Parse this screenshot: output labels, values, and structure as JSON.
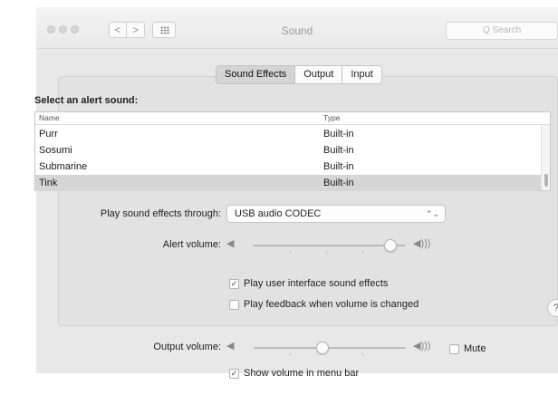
{
  "window": {
    "title": "Sound",
    "search_placeholder": "Q Search",
    "nav_back": "<",
    "nav_forward": ">"
  },
  "tabs": [
    {
      "label": "Sound Effects",
      "active": true
    },
    {
      "label": "Output",
      "active": false
    },
    {
      "label": "Input",
      "active": false
    }
  ],
  "alert": {
    "heading": "Select an alert sound:",
    "columns": [
      "Name",
      "Type"
    ],
    "rows": [
      {
        "name": "Purr",
        "type": "Built-in"
      },
      {
        "name": "Sosumi",
        "type": "Built-in"
      },
      {
        "name": "Submarine",
        "type": "Built-in"
      },
      {
        "name": "Tink",
        "type": "Built-in",
        "selected": true
      }
    ]
  },
  "play_through": {
    "label": "Play sound effects through:",
    "value": "USB audio CODEC"
  },
  "alert_volume": {
    "label": "Alert volume:",
    "level": 0.9
  },
  "checkboxes": [
    {
      "label": "Play user interface sound effects",
      "checked": true
    },
    {
      "label": "Play feedback when volume is changed",
      "checked": false
    }
  ],
  "output_volume": {
    "label": "Output volume:",
    "level": 0.45,
    "mute_label": "Mute",
    "mute_checked": false
  },
  "menu_bar": {
    "label": "Show volume in menu bar",
    "checked": true
  },
  "help": "?",
  "colors": {
    "window_bg": "#e8e8e8",
    "selected_row": "#d6d6d6"
  }
}
